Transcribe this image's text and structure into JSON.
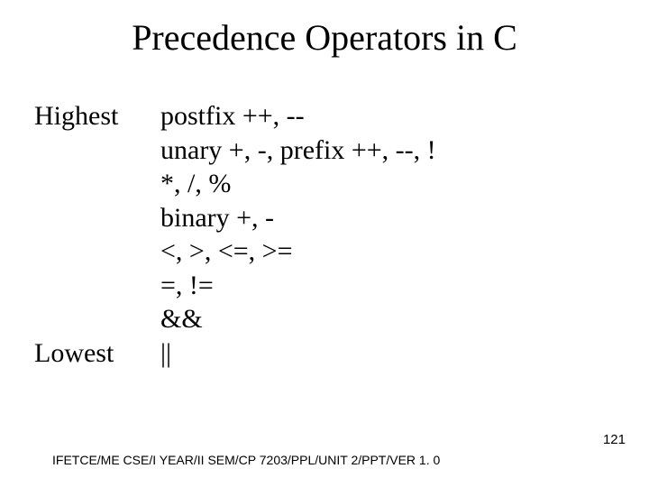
{
  "title": "Precedence Operators in C",
  "labels": {
    "highest": "Highest",
    "lowest": "Lowest"
  },
  "precedence": [
    "postfix ++, --",
    "unary +, -, prefix ++, --, !",
    "*, /, %",
    "binary +, -",
    "<, >, <=, >=",
    "=, !=",
    "&&",
    "||"
  ],
  "footer": "IFETCE/ME CSE/I YEAR/II SEM/CP 7203/PPL/UNIT 2/PPT/VER 1. 0",
  "page_number": "121"
}
